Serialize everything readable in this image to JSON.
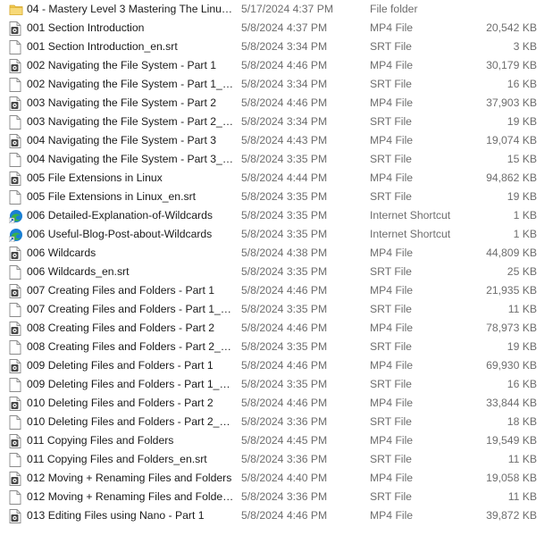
{
  "files": [
    {
      "icon": "folder-icon",
      "name": "04 - Mastery Level 3 Mastering The Linux ...",
      "date": "5/17/2024 4:37 PM",
      "type": "File folder",
      "size": ""
    },
    {
      "icon": "video-file-icon",
      "name": "001 Section Introduction",
      "date": "5/8/2024 4:37 PM",
      "type": "MP4 File",
      "size": "20,542 KB"
    },
    {
      "icon": "document-file-icon",
      "name": "001 Section Introduction_en.srt",
      "date": "5/8/2024 3:34 PM",
      "type": "SRT File",
      "size": "3 KB"
    },
    {
      "icon": "video-file-icon",
      "name": "002 Navigating the File System - Part 1",
      "date": "5/8/2024 4:46 PM",
      "type": "MP4 File",
      "size": "30,179 KB"
    },
    {
      "icon": "document-file-icon",
      "name": "002 Navigating the File System - Part 1_e...",
      "date": "5/8/2024 3:34 PM",
      "type": "SRT File",
      "size": "16 KB"
    },
    {
      "icon": "video-file-icon",
      "name": "003 Navigating the File System - Part 2",
      "date": "5/8/2024 4:46 PM",
      "type": "MP4 File",
      "size": "37,903 KB"
    },
    {
      "icon": "document-file-icon",
      "name": "003 Navigating the File System - Part 2_e...",
      "date": "5/8/2024 3:34 PM",
      "type": "SRT File",
      "size": "19 KB"
    },
    {
      "icon": "video-file-icon",
      "name": "004 Navigating the File System - Part 3",
      "date": "5/8/2024 4:43 PM",
      "type": "MP4 File",
      "size": "19,074 KB"
    },
    {
      "icon": "document-file-icon",
      "name": "004 Navigating the File System - Part 3_e...",
      "date": "5/8/2024 3:35 PM",
      "type": "SRT File",
      "size": "15 KB"
    },
    {
      "icon": "video-file-icon",
      "name": "005 File Extensions in Linux",
      "date": "5/8/2024 4:44 PM",
      "type": "MP4 File",
      "size": "94,862 KB"
    },
    {
      "icon": "document-file-icon",
      "name": "005 File Extensions in Linux_en.srt",
      "date": "5/8/2024 3:35 PM",
      "type": "SRT File",
      "size": "19 KB"
    },
    {
      "icon": "edge-shortcut-icon",
      "name": "006 Detailed-Explanation-of-Wildcards",
      "date": "5/8/2024 3:35 PM",
      "type": "Internet Shortcut",
      "size": "1 KB"
    },
    {
      "icon": "edge-shortcut-icon",
      "name": "006 Useful-Blog-Post-about-Wildcards",
      "date": "5/8/2024 3:35 PM",
      "type": "Internet Shortcut",
      "size": "1 KB"
    },
    {
      "icon": "video-file-icon",
      "name": "006 Wildcards",
      "date": "5/8/2024 4:38 PM",
      "type": "MP4 File",
      "size": "44,809 KB"
    },
    {
      "icon": "document-file-icon",
      "name": "006 Wildcards_en.srt",
      "date": "5/8/2024 3:35 PM",
      "type": "SRT File",
      "size": "25 KB"
    },
    {
      "icon": "video-file-icon",
      "name": "007 Creating Files and Folders - Part 1",
      "date": "5/8/2024 4:46 PM",
      "type": "MP4 File",
      "size": "21,935 KB"
    },
    {
      "icon": "document-file-icon",
      "name": "007 Creating Files and Folders - Part 1_en...",
      "date": "5/8/2024 3:35 PM",
      "type": "SRT File",
      "size": "11 KB"
    },
    {
      "icon": "video-file-icon",
      "name": "008 Creating Files and Folders - Part 2",
      "date": "5/8/2024 4:46 PM",
      "type": "MP4 File",
      "size": "78,973 KB"
    },
    {
      "icon": "document-file-icon",
      "name": "008 Creating Files and Folders - Part 2_en...",
      "date": "5/8/2024 3:35 PM",
      "type": "SRT File",
      "size": "19 KB"
    },
    {
      "icon": "video-file-icon",
      "name": "009 Deleting Files and Folders - Part 1",
      "date": "5/8/2024 4:46 PM",
      "type": "MP4 File",
      "size": "69,930 KB"
    },
    {
      "icon": "document-file-icon",
      "name": "009 Deleting Files and Folders - Part 1_en...",
      "date": "5/8/2024 3:35 PM",
      "type": "SRT File",
      "size": "16 KB"
    },
    {
      "icon": "video-file-icon",
      "name": "010 Deleting Files and Folders - Part 2",
      "date": "5/8/2024 4:46 PM",
      "type": "MP4 File",
      "size": "33,844 KB"
    },
    {
      "icon": "document-file-icon",
      "name": "010 Deleting Files and Folders - Part 2_en...",
      "date": "5/8/2024 3:36 PM",
      "type": "SRT File",
      "size": "18 KB"
    },
    {
      "icon": "video-file-icon",
      "name": "011 Copying Files and Folders",
      "date": "5/8/2024 4:45 PM",
      "type": "MP4 File",
      "size": "19,549 KB"
    },
    {
      "icon": "document-file-icon",
      "name": "011 Copying Files and Folders_en.srt",
      "date": "5/8/2024 3:36 PM",
      "type": "SRT File",
      "size": "11 KB"
    },
    {
      "icon": "video-file-icon",
      "name": "012 Moving + Renaming Files and Folders",
      "date": "5/8/2024 4:40 PM",
      "type": "MP4 File",
      "size": "19,058 KB"
    },
    {
      "icon": "document-file-icon",
      "name": "012 Moving + Renaming Files and Folder...",
      "date": "5/8/2024 3:36 PM",
      "type": "SRT File",
      "size": "11 KB"
    },
    {
      "icon": "video-file-icon",
      "name": "013 Editing Files using Nano - Part 1",
      "date": "5/8/2024 4:46 PM",
      "type": "MP4 File",
      "size": "39,872 KB"
    }
  ],
  "colors": {
    "folder": "#f2c94c",
    "video_badge": "#e9e9e9",
    "edge_blue": "#1a7fd6",
    "edge_green": "#38b24a"
  }
}
